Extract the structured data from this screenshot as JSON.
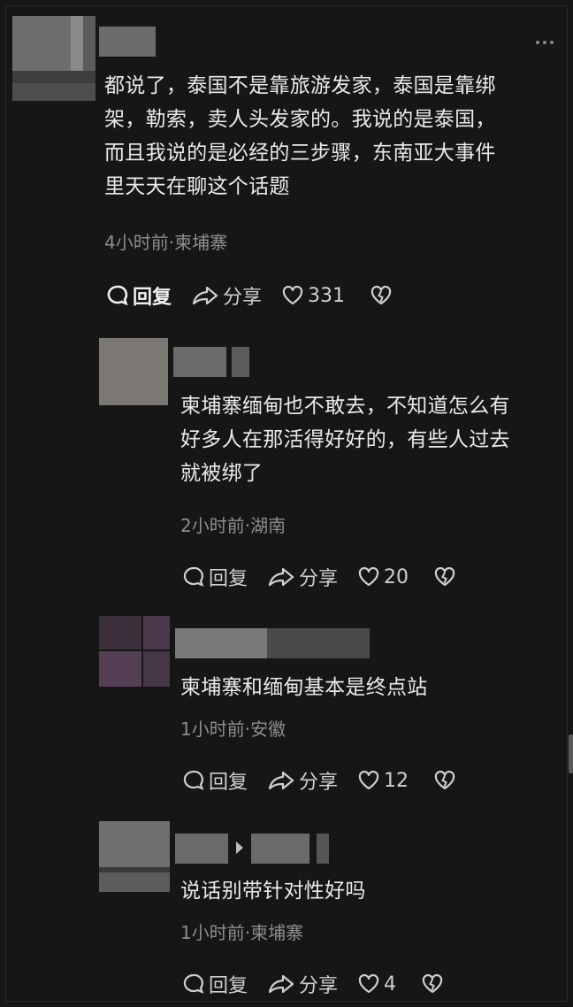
{
  "comments": [
    {
      "text_lines": [
        "都说了，泰国不是靠旅游发家，泰国是靠绑",
        "架，勒索，卖人头发家的。我说的是泰国，",
        "而且我说的是必经的三步骤，东南亚大事件",
        "里天天在聊这个话题"
      ],
      "meta": "4小时前·柬埔寨",
      "reply_label": "回复",
      "share_label": "分享",
      "likes": "331"
    },
    {
      "text_lines": [
        "柬埔寨缅甸也不敢去，不知道怎么有",
        "好多人在那活得好好的，有些人过去",
        "就被绑了"
      ],
      "meta": "2小时前·湖南",
      "reply_label": "回复",
      "share_label": "分享",
      "likes": "20"
    },
    {
      "text_lines": [
        "柬埔寨和缅甸基本是终点站"
      ],
      "meta": "1小时前·安徽",
      "reply_label": "回复",
      "share_label": "分享",
      "likes": "12"
    },
    {
      "text_lines": [
        "说话别带针对性好吗"
      ],
      "meta": "1小时前·柬埔寨",
      "reply_label": "回复",
      "share_label": "分享",
      "likes": "4"
    }
  ],
  "icons": {
    "reply": "comment-bubble-icon",
    "share": "share-arrow-icon",
    "like": "heart-icon",
    "dislike": "broken-heart-icon",
    "more": "more-dots-icon"
  },
  "colors": {
    "background": "#161616",
    "text": "#eaeaea",
    "meta": "#8d8d8d"
  }
}
